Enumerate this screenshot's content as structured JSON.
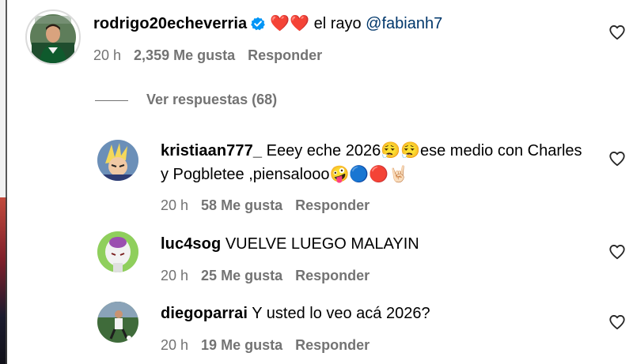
{
  "colors": {
    "username": "#000000",
    "mention": "#00376b",
    "meta": "#737373",
    "verified": "#0095f6",
    "red_heart": "#e0245e"
  },
  "main_comment": {
    "username": "rodrigo20echeverria",
    "verified": true,
    "text": "❤️❤️ el rayo",
    "mention": "@fabianh7",
    "time": "20 h",
    "likes": "2,359 Me gusta",
    "reply": "Responder",
    "avatar_icon": "avatar-player-icon",
    "like_icon": "heart-outline-icon"
  },
  "replies_toggle": {
    "label": "Ver respuestas (68)"
  },
  "replies": [
    {
      "username": "kristiaan777_",
      "text": "Eeey eche 2026😮‍💨😮‍💨ese medio con Charles y Pogbletee ,piensalooo🤪🔵🔴🤘🏻",
      "time": "20 h",
      "likes": "58 Me gusta",
      "reply": "Responder",
      "avatar_icon": "avatar-anime-icon",
      "like_icon": "heart-outline-icon"
    },
    {
      "username": "luc4sog",
      "text": "VUELVE LUEGO MALAYIN",
      "time": "20 h",
      "likes": "25 Me gusta",
      "reply": "Responder",
      "avatar_icon": "avatar-frieza-icon",
      "like_icon": "heart-outline-icon"
    },
    {
      "username": "diegoparrai",
      "text": "Y usted lo veo acá 2026?",
      "time": "20 h",
      "likes": "19 Me gusta",
      "reply": "Responder",
      "avatar_icon": "avatar-soccer-icon",
      "like_icon": "heart-outline-icon"
    }
  ]
}
